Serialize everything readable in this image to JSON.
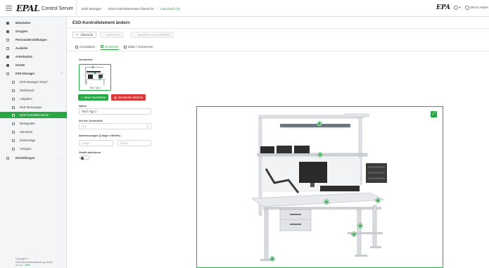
{
  "topbar": {
    "logo_mark": "EPAL",
    "logo_text": "Control Server",
    "breadcrumb": [
      "ESD Manager",
      "ESD Kontrollelemente Übersicht",
      "Laborbuch (4)"
    ],
    "brand_right": "EPA",
    "user_label": "Simon Huber"
  },
  "sidebar": {
    "items": [
      {
        "label": "Mitarbeiter"
      },
      {
        "label": "Gruppen"
      },
      {
        "label": "Personaleinstellungen"
      },
      {
        "label": "Ausleihe"
      },
      {
        "label": "Arbeitsplatz"
      },
      {
        "label": "Geräte"
      },
      {
        "label": "ESD-Manager"
      },
      {
        "label": "ESD-Manager Ablauf"
      },
      {
        "label": "Dashboard"
      },
      {
        "label": "Aufgaben"
      },
      {
        "label": "ESD Messungen"
      },
      {
        "label": "ESD Kontrollelemente"
      },
      {
        "label": "Messgeräte"
      },
      {
        "label": "Standorte"
      },
      {
        "label": "Zeitverträge"
      },
      {
        "label": "Vorlagen"
      },
      {
        "label": "Einstellungen"
      }
    ],
    "copyright": [
      "Copyright ©",
      "EPA Sicherheitsbekleidung GmbH",
      "v1.3.0 –"
    ],
    "copyright_link": "Mehr"
  },
  "main": {
    "title": "ESD-Kontrollelement ändern",
    "toolbar": {
      "back": "Übersicht",
      "save": "Speichern",
      "save_close": "Speichern und schließen"
    },
    "tabs": [
      {
        "label": "Grunddaten"
      },
      {
        "label": "Geometrie"
      },
      {
        "label": "Bilder / Dokumente"
      }
    ],
    "geometry_label": "Geometrie",
    "thumb_label": "Tisch Typ 1",
    "new_geometry": "Neue Geometrie",
    "delete_geometry": "Geometrie löschen",
    "name_label": "Name",
    "name_value": "Tisch Typ 1",
    "type_label": "Art der Geometrie",
    "type_value": "Box",
    "dims_label": "Abmessungen (Länge x Breite)",
    "length_placeholder": "Länge",
    "width_placeholder": "Breite",
    "active_label": "Grafik aktivieren",
    "active_value": false
  },
  "colors": {
    "accent": "#27a844",
    "danger": "#d83838",
    "sidebar_bg": "#f4f5f7"
  }
}
